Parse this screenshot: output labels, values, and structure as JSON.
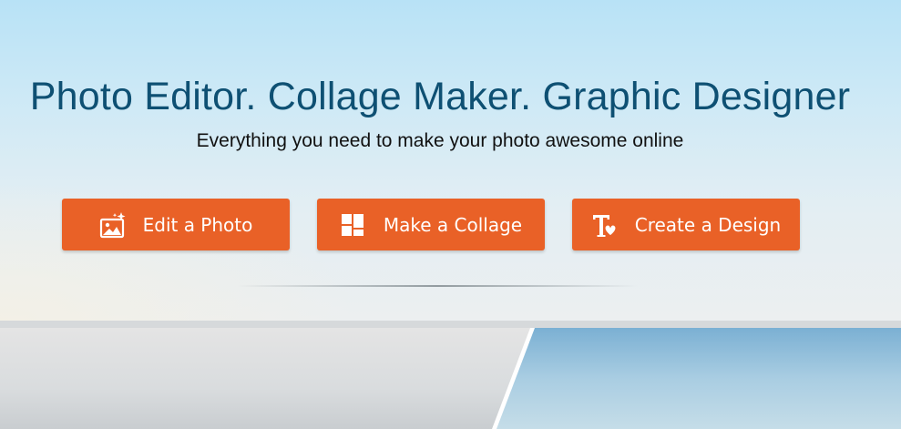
{
  "hero": {
    "title": "Photo Editor. Collage Maker. Graphic Designer",
    "subtitle": "Everything you need to make your photo awesome online"
  },
  "buttons": [
    {
      "label": "Edit a Photo",
      "icon": "edit-photo-icon"
    },
    {
      "label": "Make a Collage",
      "icon": "collage-grid-icon"
    },
    {
      "label": "Create a Design",
      "icon": "design-text-heart-icon"
    }
  ],
  "colors": {
    "title": "#0e5073",
    "button": "#e96127",
    "button_text": "#ffffff"
  }
}
